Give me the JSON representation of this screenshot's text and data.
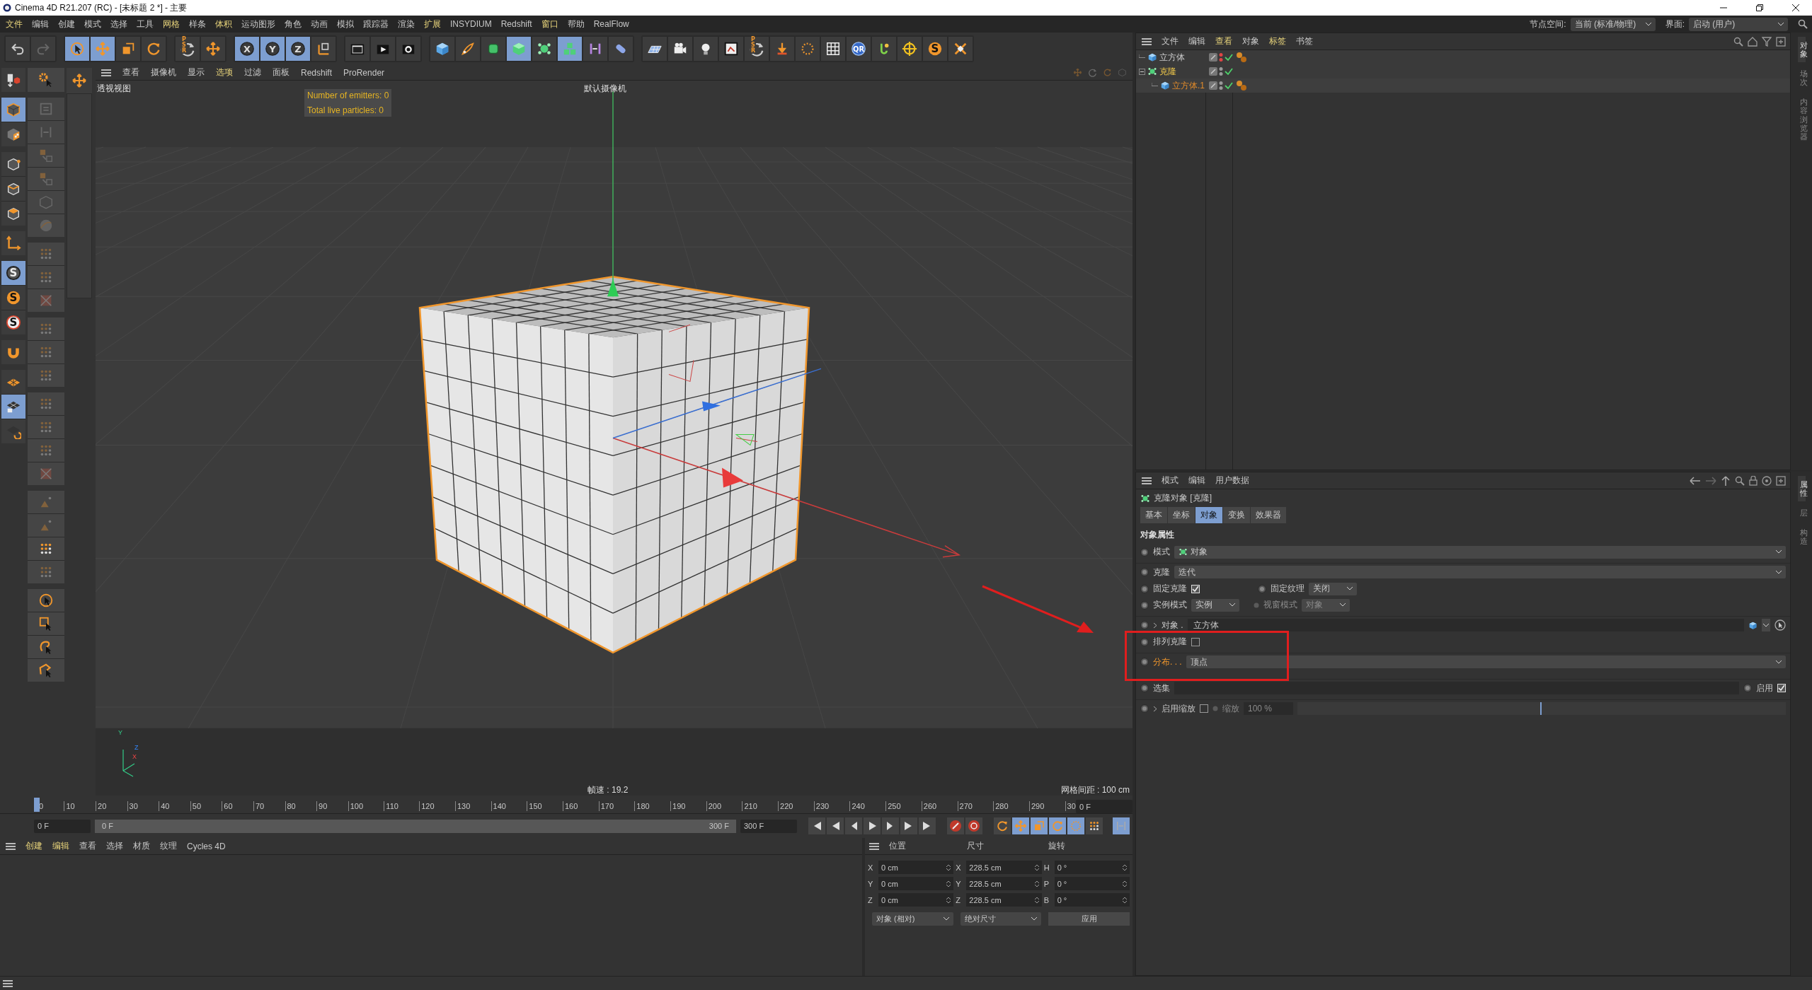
{
  "window": {
    "title": "Cinema 4D R21.207 (RC) - [未标题 2 *] - 主要"
  },
  "menu_bar": [
    {
      "label": "文件",
      "accent": true
    },
    {
      "label": "编辑",
      "accent": false
    },
    {
      "label": "创建",
      "accent": false
    },
    {
      "label": "模式",
      "accent": false
    },
    {
      "label": "选择",
      "accent": false
    },
    {
      "label": "工具",
      "accent": false
    },
    {
      "label": "网格",
      "accent": true
    },
    {
      "label": "样条",
      "accent": false
    },
    {
      "label": "体积",
      "accent": true
    },
    {
      "label": "运动图形",
      "accent": false
    },
    {
      "label": "角色",
      "accent": false
    },
    {
      "label": "动画",
      "accent": false
    },
    {
      "label": "模拟",
      "accent": false
    },
    {
      "label": "跟踪器",
      "accent": false
    },
    {
      "label": "渲染",
      "accent": false
    },
    {
      "label": "扩展",
      "accent": true
    },
    {
      "label": "INSYDIUM",
      "accent": false
    },
    {
      "label": "Redshift",
      "accent": false
    },
    {
      "label": "窗口",
      "accent": true
    },
    {
      "label": "帮助",
      "accent": false
    },
    {
      "label": "RealFlow",
      "accent": false
    }
  ],
  "node_space": {
    "label": "节点空间:",
    "value": "当前 (标准/物理)"
  },
  "layout": {
    "label": "界面:",
    "value": "启动 (用户)"
  },
  "toolbar": [
    [
      {
        "kind": "undo",
        "selected": false
      },
      {
        "kind": "redo",
        "selected": false
      }
    ],
    [
      {
        "kind": "select",
        "selected": true
      },
      {
        "kind": "move",
        "selected": true
      },
      {
        "kind": "scale",
        "selected": false
      },
      {
        "kind": "rotate",
        "selected": false
      }
    ],
    [
      {
        "kind": "psr",
        "label": "PSR",
        "selected": false
      },
      {
        "kind": "plus",
        "selected": false
      }
    ],
    [
      {
        "kind": "axis",
        "label": "X",
        "selected": true
      },
      {
        "kind": "axis",
        "label": "Y",
        "selected": true
      },
      {
        "kind": "axis",
        "label": "Z",
        "selected": true
      },
      {
        "kind": "coord",
        "selected": false
      }
    ],
    [
      {
        "kind": "clapper",
        "selected": false
      },
      {
        "kind": "play",
        "selected": false
      },
      {
        "kind": "gearclap",
        "selected": false
      }
    ],
    [
      {
        "kind": "cube",
        "selected": false
      },
      {
        "kind": "pen",
        "selected": false
      },
      {
        "kind": "subdiv",
        "selected": false
      },
      {
        "kind": "greencube",
        "selected": true
      },
      {
        "kind": "cloner",
        "selected": false
      },
      {
        "kind": "cubes",
        "selected": true
      },
      {
        "kind": "bend",
        "selected": false
      },
      {
        "kind": "capsule",
        "selected": false
      }
    ],
    [
      {
        "kind": "floor",
        "selected": false
      },
      {
        "kind": "camera",
        "selected": false
      },
      {
        "kind": "bulb",
        "selected": false
      },
      {
        "kind": "frame",
        "selected": false
      },
      {
        "kind": "psr",
        "label": "PSR",
        "selected": false
      },
      {
        "kind": "drop",
        "selected": false
      },
      {
        "kind": "ring",
        "selected": false
      },
      {
        "kind": "grid",
        "selected": false
      },
      {
        "kind": "qr",
        "label": "QR",
        "selected": false
      },
      {
        "kind": "hook",
        "selected": false
      },
      {
        "kind": "target",
        "selected": false
      },
      {
        "kind": "s",
        "label": "S",
        "selected": false
      },
      {
        "kind": "burst",
        "selected": false
      }
    ]
  ],
  "mode_tools": [
    [
      {
        "kind": "model",
        "selected": false
      }
    ],
    [
      {
        "kind": "cube-solid",
        "selected": true
      },
      {
        "kind": "checker",
        "selected": false
      }
    ],
    [
      {
        "kind": "points",
        "selected": false
      },
      {
        "kind": "edges",
        "selected": false
      },
      {
        "kind": "polys",
        "selected": false
      }
    ],
    [
      {
        "kind": "axis-l",
        "selected": false
      }
    ],
    [
      {
        "kind": "snap",
        "label": "S",
        "selected": true
      },
      {
        "kind": "snap-o",
        "label": "S",
        "selected": false
      },
      {
        "kind": "snap-w",
        "label": "S",
        "selected": false
      }
    ],
    [
      {
        "kind": "magnet",
        "selected": false
      }
    ],
    [
      {
        "kind": "plane",
        "selected": false
      },
      {
        "kind": "plane-lock",
        "selected": true
      },
      {
        "kind": "plane-rot",
        "selected": false
      }
    ]
  ],
  "mesh_tools": [
    [
      {
        "kind": "gear-arrow",
        "disabled": false
      }
    ],
    [
      {
        "kind": "swap",
        "disabled": true
      },
      {
        "kind": "bars",
        "disabled": true
      },
      {
        "kind": "box-arrow",
        "disabled": true
      },
      {
        "kind": "box-arrow",
        "disabled": true
      },
      {
        "kind": "cube-line",
        "disabled": true
      },
      {
        "kind": "sphere",
        "disabled": true
      }
    ],
    [
      {
        "kind": "dots",
        "disabled": true
      },
      {
        "kind": "dots",
        "disabled": true
      },
      {
        "kind": "cross-box",
        "disabled": true
      }
    ],
    [
      {
        "kind": "dots",
        "disabled": true
      },
      {
        "kind": "dots",
        "disabled": true
      },
      {
        "kind": "dots",
        "disabled": true
      }
    ],
    [
      {
        "kind": "dots",
        "disabled": true
      },
      {
        "kind": "dots",
        "disabled": true
      },
      {
        "kind": "dots",
        "disabled": true
      },
      {
        "kind": "cross-box",
        "disabled": true
      }
    ],
    [
      {
        "kind": "tri",
        "disabled": true
      },
      {
        "kind": "tri",
        "disabled": true
      },
      {
        "kind": "dots",
        "disabled": false
      },
      {
        "kind": "dots",
        "disabled": true
      }
    ],
    [
      {
        "kind": "circle-sel",
        "disabled": false
      },
      {
        "kind": "rect-sel",
        "disabled": false
      },
      {
        "kind": "lasso",
        "disabled": false
      },
      {
        "kind": "poly-sel",
        "disabled": false
      }
    ]
  ],
  "viewport": {
    "menu": [
      {
        "label": "查看",
        "accent": false
      },
      {
        "label": "摄像机",
        "accent": false
      },
      {
        "label": "显示",
        "accent": false
      },
      {
        "label": "选项",
        "accent": true
      },
      {
        "label": "过滤",
        "accent": false
      },
      {
        "label": "面板",
        "accent": false
      },
      {
        "label": "Redshift",
        "accent": false
      },
      {
        "label": "ProRender",
        "accent": false
      }
    ],
    "view_name": "透视视图",
    "camera": "默认摄像机",
    "hud": [
      "Number of emitters: 0",
      "Total live particles: 0"
    ],
    "axis_labels": [
      "Y",
      "Z",
      "X"
    ],
    "fps": "帧速 : 19.2",
    "grid_spacing": "网格间距 : 100 cm"
  },
  "timeline": {
    "ruler": [
      "0",
      "10",
      "20",
      "30",
      "40",
      "50",
      "60",
      "70",
      "80",
      "90",
      "100",
      "110",
      "120",
      "130",
      "140",
      "150",
      "160",
      "170",
      "180",
      "190",
      "200",
      "210",
      "220",
      "230",
      "240",
      "250",
      "260",
      "270",
      "280",
      "290",
      "30"
    ],
    "current_frame": "0 F",
    "start": "0 F",
    "range_start": "0 F",
    "range_end": "300 F",
    "range_bar": {
      "level": 1
    },
    "end": "300 F"
  },
  "materials": {
    "menu": [
      {
        "label": "创建",
        "accent": true
      },
      {
        "label": "编辑",
        "accent": true
      },
      {
        "label": "查看",
        "accent": false
      },
      {
        "label": "选择",
        "accent": false
      },
      {
        "label": "材质",
        "accent": false
      },
      {
        "label": "纹理",
        "accent": false
      },
      {
        "label": "Cycles 4D",
        "accent": false
      }
    ]
  },
  "coordinates": {
    "headers": [
      "位置",
      "尺寸",
      "旋转"
    ],
    "rows": [
      {
        "axis": "X",
        "position": "0 cm",
        "size_axis": "X",
        "size": "228.5 cm",
        "rot_axis": "H",
        "rotation": "0 °"
      },
      {
        "axis": "Y",
        "position": "0 cm",
        "size_axis": "Y",
        "size": "228.5 cm",
        "rot_axis": "P",
        "rotation": "0 °"
      },
      {
        "axis": "Z",
        "position": "0 cm",
        "size_axis": "Z",
        "size": "228.5 cm",
        "rot_axis": "B",
        "rotation": "0 °"
      }
    ],
    "mode": "对象 (相对)",
    "size_mode": "绝对尺寸",
    "apply": "应用"
  },
  "object_manager": {
    "menu": [
      {
        "label": "文件",
        "accent": false
      },
      {
        "label": "编辑",
        "accent": false
      },
      {
        "label": "查看",
        "accent": true
      },
      {
        "label": "对象",
        "accent": false
      },
      {
        "label": "标签",
        "accent": true
      },
      {
        "label": "书签",
        "accent": false
      }
    ],
    "objects": [
      {
        "name": "立方体",
        "kind": "cube",
        "selected": false,
        "highlighted": false,
        "visible": false,
        "tags": true
      },
      {
        "name": "克隆",
        "kind": "cloner",
        "selected": false,
        "highlighted": true,
        "visible": true,
        "tags": false,
        "expanded": true,
        "children": [
          {
            "name": "立方体.1",
            "kind": "cube",
            "selected": true,
            "visible": true,
            "tags": true
          }
        ]
      }
    ],
    "side_tabs": [
      {
        "label": "对象",
        "selected": true
      },
      {
        "label": "场次",
        "selected": false
      },
      {
        "label": "内容浏览器",
        "selected": false
      }
    ]
  },
  "attributes": {
    "menu": [
      "模式",
      "编辑",
      "用户数据"
    ],
    "title": "克隆对象 [克隆]",
    "tabs": [
      {
        "label": "基本",
        "selected": false
      },
      {
        "label": "坐标",
        "selected": false
      },
      {
        "label": "对象",
        "selected": true
      },
      {
        "label": "变换",
        "selected": false
      },
      {
        "label": "效果器",
        "selected": false
      }
    ],
    "section": "对象属性",
    "rows": [
      {
        "kind": "dropdown",
        "label": "模式",
        "value": "对象",
        "icon": true
      },
      {
        "kind": "dropdown",
        "label": "克隆",
        "value": "迭代"
      },
      {
        "kind": "check-dropdown",
        "label": "固定克隆",
        "checked": true,
        "label2": "固定纹理",
        "value2": "关闭"
      },
      {
        "kind": "dropdown-pair",
        "label": "实例模式",
        "value": "实例",
        "label2": "视窗模式",
        "value2": "对象",
        "disabled2": true
      },
      {
        "kind": "link",
        "label": "对象 .",
        "value": "立方体"
      },
      {
        "kind": "checkbox",
        "label": "排列克隆",
        "checked": false
      },
      {
        "kind": "dropdown",
        "label": "分布. . .",
        "value": "顶点",
        "accent": true
      },
      {
        "kind": "selection",
        "label": "选集",
        "label2": "启用",
        "checked": true
      },
      {
        "kind": "scale",
        "label": "启用缩放",
        "checked": false,
        "label2": "缩放",
        "value2": "100 %",
        "level": 0.5
      }
    ],
    "side_tabs": [
      {
        "label": "属性",
        "selected": true
      },
      {
        "label": "层",
        "selected": false
      },
      {
        "label": "构造",
        "selected": false
      }
    ]
  },
  "annotations": {
    "arrow": true,
    "frame": true
  }
}
